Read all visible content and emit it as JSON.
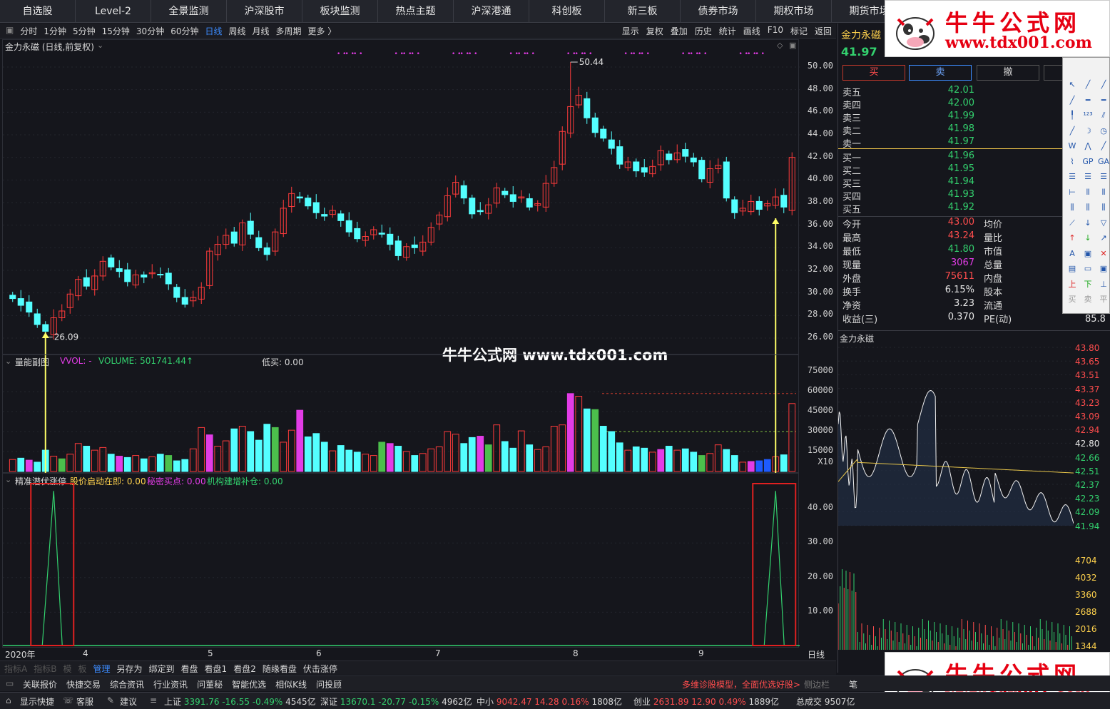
{
  "nav": [
    "自选股",
    "Level-2",
    "全景监测",
    "沪深股市",
    "板块监测",
    "热点主题",
    "沪深港通",
    "科创板",
    "新三板",
    "债券市场",
    "期权市场",
    "期货市场"
  ],
  "periods": [
    "分时",
    "1分钟",
    "5分钟",
    "15分钟",
    "30分钟",
    "60分钟",
    "日线",
    "周线",
    "月线",
    "多周期",
    "更多 〉"
  ],
  "selected_period": "日线",
  "tools_right": [
    "显示",
    "复权",
    "叠加",
    "历史",
    "统计",
    "画线",
    "F10",
    "标记",
    "返回"
  ],
  "stock_title": "金力永磁 (日线,前复权)",
  "price_axis": [
    "50.00",
    "48.00",
    "46.00",
    "44.00",
    "42.00",
    "40.00",
    "38.00",
    "36.00",
    "34.00",
    "32.00",
    "30.00",
    "28.00",
    "26.00"
  ],
  "high_label": "50.44",
  "low_label": "26.09",
  "vol_title": {
    "name": "量能副图",
    "vvol": "VVOL: -",
    "volume": "VOLUME: 501741.44↑",
    "lowbuy": "低买: 0.00"
  },
  "vol_axis": [
    "75000",
    "60000",
    "45000",
    "30000",
    "15000",
    "X10"
  ],
  "ind_title": {
    "name": "精准潜伏涨停",
    "a": "股价启动在即: 0.00",
    "b": "秘密买点: 0.00",
    "c": "机构建增补仓: 0.00"
  },
  "ind_axis": [
    "40.00",
    "30.00",
    "20.00",
    "10.00"
  ],
  "x_axis": [
    "2020年",
    "4",
    "5",
    "6",
    "7",
    "8",
    "9"
  ],
  "watermark": "牛牛公式网 www.tdx001.com",
  "quote": {
    "name": "金力永磁",
    "price": "41.97",
    "buttons": [
      "买",
      "卖",
      "撤"
    ],
    "asks": [
      [
        "卖五",
        "42.01"
      ],
      [
        "卖四",
        "42.00"
      ],
      [
        "卖三",
        "41.99"
      ],
      [
        "卖二",
        "41.98"
      ],
      [
        "卖一",
        "41.97"
      ]
    ],
    "bids": [
      [
        "买一",
        "41.96"
      ],
      [
        "买二",
        "41.95"
      ],
      [
        "买三",
        "41.94"
      ],
      [
        "买四",
        "41.93"
      ],
      [
        "买五",
        "41.92"
      ]
    ],
    "stats": [
      [
        "今开",
        "43.00",
        "均价"
      ],
      [
        "最高",
        "43.24",
        "量比"
      ],
      [
        "最低",
        "41.80",
        "市值"
      ],
      [
        "现量",
        "3067",
        "总量"
      ],
      [
        "外盘",
        "75611",
        "内盘"
      ],
      [
        "换手",
        "6.15%",
        "股本"
      ],
      [
        "净资",
        "3.23",
        "流通"
      ],
      [
        "收益(三)",
        "0.370",
        "PE(动)"
      ]
    ],
    "pe_value": "85.8"
  },
  "intraday": {
    "title": "金力永磁",
    "price_axis": [
      "43.80",
      "43.65",
      "43.51",
      "43.37",
      "43.23",
      "43.09",
      "42.94",
      "42.80",
      "42.66",
      "42.51",
      "42.37",
      "42.23",
      "42.09",
      "41.94"
    ],
    "vol_axis": [
      "4704",
      "4032",
      "3360",
      "2688",
      "2016",
      "1344"
    ]
  },
  "tabs": [
    "指标A",
    "指标B",
    "模",
    "板",
    "管理",
    "另存为",
    "绑定到",
    "看盘",
    "看盘1",
    "看盘2",
    "随缘看盘",
    "伏击涨停"
  ],
  "bar2": {
    "items": [
      "关联报价",
      "快捷交易",
      "综合资讯",
      "行业资讯",
      "问董秘",
      "智能优选",
      "相似K线",
      "问投顾"
    ],
    "promo": "多维诊股模型，全面优选好股>",
    "side": "侧边栏",
    "bi": "笔"
  },
  "status": {
    "left": [
      "显示快捷",
      "客服",
      "建议"
    ],
    "sh": {
      "name": "上证",
      "v": "3391.76",
      "chg": "-16.55",
      "pct": "-0.49%",
      "amt": "4545亿"
    },
    "sz": {
      "name": "深证",
      "v": "13670.1",
      "chg": "-20.77",
      "pct": "-0.15%",
      "amt": "4962亿"
    },
    "zx": {
      "name": "中小",
      "v": "9042.47",
      "chg": "14.28",
      "pct": "0.16%",
      "amt": "1808亿"
    },
    "cy": {
      "name": "创业",
      "v": "2631.89",
      "chg": "12.90",
      "pct": "0.49%",
      "amt": "1889亿"
    },
    "total": {
      "name": "总成交",
      "v": "9507亿"
    }
  },
  "logo": {
    "t1": "牛牛公式网",
    "t2": "www.tdx001.com"
  },
  "colors": {
    "up": "#ff3b3b",
    "down": "#54ffff",
    "bg": "#15161c",
    "accent": "#3c8cff",
    "signal": "#ffff66"
  },
  "chart_data": [
    {
      "type": "candlestick",
      "title": "金力永磁 (日线,前复权)",
      "ylim": [
        26.0,
        50.44
      ],
      "close": [
        29.5,
        28.9,
        28.3,
        27.2,
        26.6,
        27.8,
        28.4,
        29.9,
        31.2,
        30.6,
        31.5,
        32.8,
        32.3,
        31.9,
        31.0,
        31.6,
        31.4,
        31.8,
        31.6,
        30.8,
        29.6,
        29.0,
        29.6,
        30.5,
        33.7,
        34.3,
        35.1,
        34.4,
        36.2,
        35.2,
        34.0,
        33.4,
        35.4,
        37.5,
        38.8,
        38.4,
        37.7,
        37.1,
        36.8,
        37.3,
        36.4,
        35.4,
        34.8,
        35.0,
        35.6,
        35.2,
        34.3,
        33.3,
        34.1,
        34.0,
        34.5,
        35.8,
        36.9,
        38.6,
        39.8,
        38.4,
        37.0,
        37.2,
        37.8,
        39.3,
        38.7,
        38.1,
        38.5,
        37.6,
        37.9,
        39.7,
        41.1,
        44.3,
        46.5,
        47.5,
        45.5,
        44.2,
        43.7,
        42.8,
        41.4,
        41.6,
        40.8,
        40.7,
        41.2,
        42.6,
        41.8,
        42.4,
        42.1,
        41.6,
        40.1,
        41.0,
        41.3,
        38.4,
        37.1,
        37.5,
        38.1,
        37.4,
        37.9,
        38.5,
        37.6,
        42.0
      ]
    },
    {
      "type": "bar",
      "title": "量能副图",
      "ylim": [
        0,
        75000
      ],
      "values": [
        9000,
        10000,
        8500,
        7000,
        16000,
        11500,
        9500,
        13000,
        21000,
        19000,
        16000,
        18000,
        13000,
        11500,
        10500,
        12000,
        9500,
        11000,
        13000,
        12000,
        8000,
        9000,
        17000,
        33000,
        27500,
        19000,
        23000,
        32000,
        34000,
        30000,
        23500,
        35500,
        33000,
        22000,
        31000,
        46000,
        26000,
        28500,
        22000,
        15500,
        19500,
        16000,
        14500,
        13000,
        12000,
        22000,
        21000,
        19000,
        15000,
        12000,
        13500,
        17000,
        18500,
        30000,
        28000,
        21000,
        25500,
        26500,
        20000,
        35000,
        22500,
        17500,
        30500,
        20000,
        16500,
        18500,
        34000,
        35000,
        58500,
        56500,
        47000,
        46500,
        34000,
        30000,
        21500,
        16000,
        18500,
        17500,
        14500,
        16500,
        19000,
        16000,
        17000,
        14500,
        12000,
        13500,
        20000,
        16500,
        12000,
        7000,
        7500,
        8000,
        9000,
        11000,
        12500,
        51000
      ]
    },
    {
      "type": "line",
      "title": "精准潜伏涨停",
      "ylim": [
        0,
        45
      ],
      "series": [
        {
          "name": "机构建增补仓",
          "peaks": [
            {
              "x_index": 5,
              "value": 45
            },
            {
              "x_index": 93,
              "value": 45
            }
          ]
        }
      ]
    },
    {
      "type": "line",
      "title": "金力永磁",
      "ylim": [
        41.94,
        43.8
      ],
      "series": [
        {
          "name": "price"
        },
        {
          "name": "avg"
        }
      ]
    }
  ]
}
